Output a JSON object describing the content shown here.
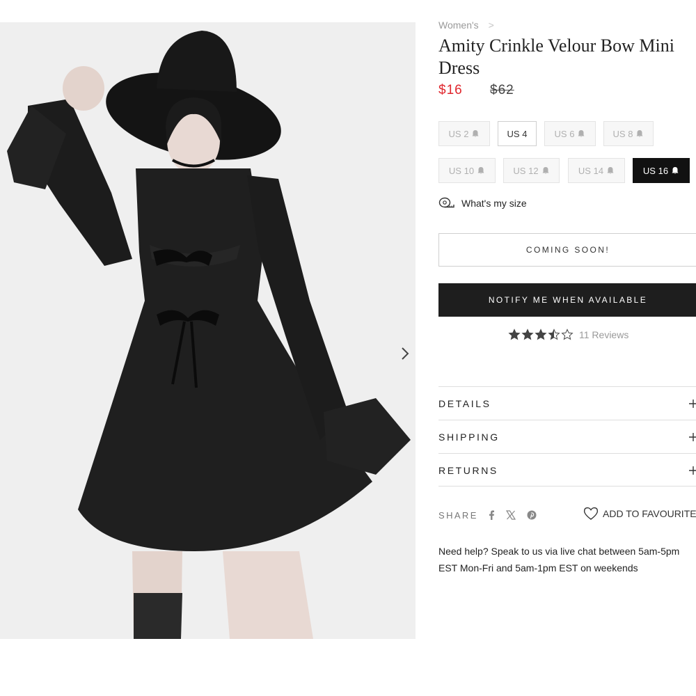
{
  "breadcrumb": {
    "category": "Women's",
    "separator": ">"
  },
  "product": {
    "title": "Amity Crinkle Velour Bow Mini Dress",
    "price_current": "$16",
    "price_original": "$62"
  },
  "sizes": [
    {
      "label": "US 2",
      "state": "unavailable"
    },
    {
      "label": "US 4",
      "state": "available"
    },
    {
      "label": "US 6",
      "state": "unavailable"
    },
    {
      "label": "US 8",
      "state": "unavailable"
    },
    {
      "label": "US 10",
      "state": "unavailable"
    },
    {
      "label": "US 12",
      "state": "unavailable"
    },
    {
      "label": "US 14",
      "state": "unavailable"
    },
    {
      "label": "US 16",
      "state": "selected"
    }
  ],
  "size_guide": {
    "label": "What's my size",
    "icon": "tape-measure-icon"
  },
  "buttons": {
    "coming_soon": "COMING SOON!",
    "notify": "NOTIFY ME WHEN AVAILABLE"
  },
  "reviews": {
    "rating": 3.5,
    "max": 5,
    "label": "11 Reviews"
  },
  "accordions": [
    {
      "label": "DETAILS",
      "icon": "plus-icon"
    },
    {
      "label": "SHIPPING",
      "icon": "plus-icon"
    },
    {
      "label": "RETURNS",
      "icon": "plus-icon"
    }
  ],
  "share": {
    "label": "SHARE",
    "icons": [
      "facebook-icon",
      "x-icon",
      "pinterest-icon"
    ]
  },
  "favourites": {
    "label": "ADD TO FAVOURITES",
    "icon": "heart-icon"
  },
  "help_text": "Need help? Speak to us via live chat between 5am-5pm EST Mon-Fri and 5am-1pm EST on weekends",
  "colors": {
    "sale_price": "#e0262d",
    "primary_dark": "#1e1e1e",
    "disabled_text": "#b0b0b0",
    "photo_background": "#efefef"
  }
}
